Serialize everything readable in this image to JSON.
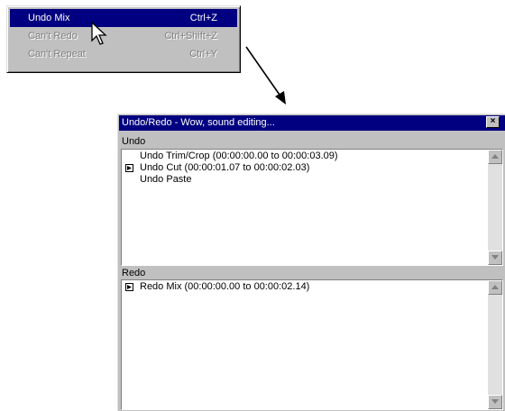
{
  "edit_menu": {
    "items": [
      {
        "label": "Undo Mix",
        "shortcut": "Ctrl+Z"
      },
      {
        "label": "Can't Redo",
        "shortcut": "Ctrl+Shift+Z"
      },
      {
        "label": "Can't Repeat",
        "shortcut": "Ctrl+Y"
      }
    ]
  },
  "window": {
    "title": "Undo/Redo - Wow, sound editing...",
    "close_glyph": "×",
    "undo": {
      "label": "Undo",
      "items": [
        "Undo Trim/Crop (00:00:00.00 to 00:00:03.09)",
        "Undo Cut (00:00:01.07 to 00:00:02.03)",
        "Undo Paste"
      ]
    },
    "redo": {
      "label": "Redo",
      "items": [
        "Redo Mix (00:00:00.00 to 00:00:02.14)"
      ]
    }
  },
  "colors": {
    "title_bar": "#000080",
    "menu_highlight": "#000080",
    "face": "#c0c0c0"
  }
}
